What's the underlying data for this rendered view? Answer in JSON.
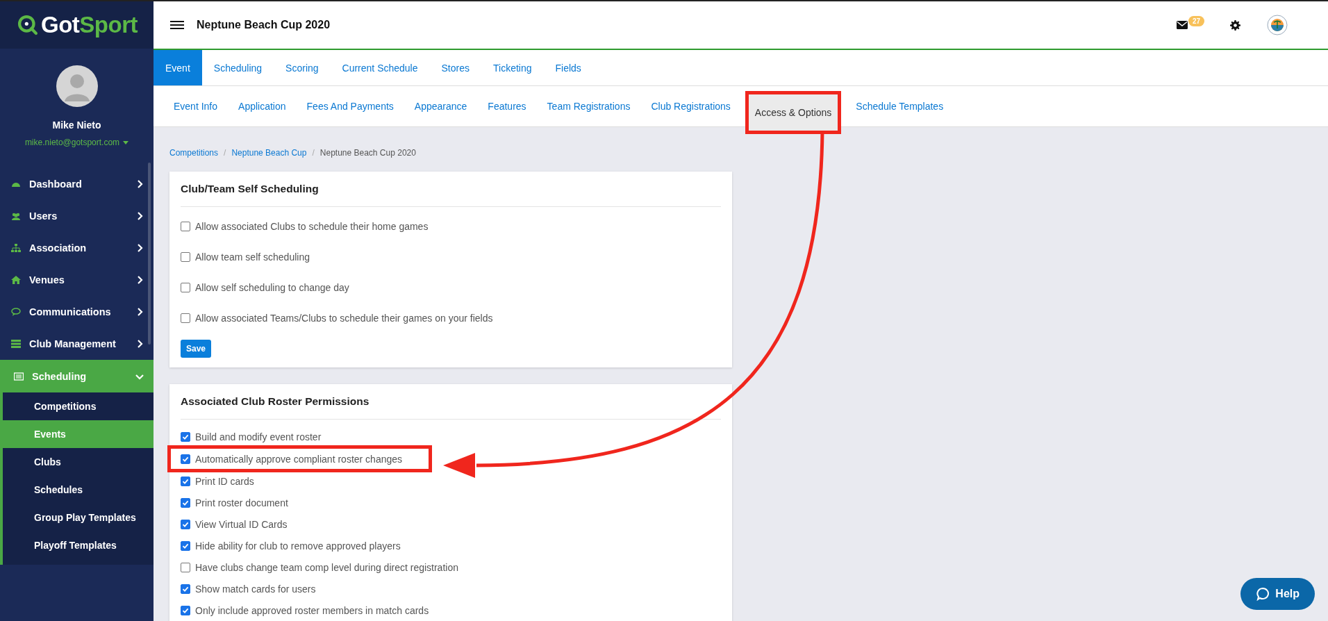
{
  "brand": {
    "name_left": "Got",
    "name_right": "Sport"
  },
  "user": {
    "name": "Mike Nieto",
    "email": "mike.nieto@gotsport.com"
  },
  "sidebar": {
    "items": [
      {
        "label": "Dashboard",
        "expanded": false,
        "selected": false
      },
      {
        "label": "Users",
        "expanded": false,
        "selected": false
      },
      {
        "label": "Association",
        "expanded": false,
        "selected": false
      },
      {
        "label": "Venues",
        "expanded": false,
        "selected": false
      },
      {
        "label": "Communications",
        "expanded": false,
        "selected": false
      },
      {
        "label": "Club Management",
        "expanded": false,
        "selected": false
      },
      {
        "label": "Scheduling",
        "expanded": true,
        "selected": true,
        "children": [
          {
            "label": "Competitions",
            "selected": false
          },
          {
            "label": "Events",
            "selected": true
          },
          {
            "label": "Clubs",
            "selected": false
          },
          {
            "label": "Schedules",
            "selected": false
          },
          {
            "label": "Group Play Templates",
            "selected": false
          },
          {
            "label": "Playoff Templates",
            "selected": false
          }
        ]
      }
    ]
  },
  "header": {
    "title": "Neptune Beach Cup 2020",
    "mail_count": "27"
  },
  "tabs": [
    {
      "label": "Event",
      "selected": true
    },
    {
      "label": "Scheduling",
      "selected": false
    },
    {
      "label": "Scoring",
      "selected": false
    },
    {
      "label": "Current Schedule",
      "selected": false
    },
    {
      "label": "Stores",
      "selected": false
    },
    {
      "label": "Ticketing",
      "selected": false
    },
    {
      "label": "Fields",
      "selected": false
    }
  ],
  "subtabs": [
    {
      "label": "Event Info",
      "selected": false,
      "highlighted": false
    },
    {
      "label": "Application",
      "selected": false,
      "highlighted": false
    },
    {
      "label": "Fees And Payments",
      "selected": false,
      "highlighted": false
    },
    {
      "label": "Appearance",
      "selected": false,
      "highlighted": false
    },
    {
      "label": "Features",
      "selected": false,
      "highlighted": false
    },
    {
      "label": "Team Registrations",
      "selected": false,
      "highlighted": false
    },
    {
      "label": "Club Registrations",
      "selected": false,
      "highlighted": false
    },
    {
      "label": "Access & Options",
      "selected": true,
      "highlighted": true
    },
    {
      "label": "Schedule Templates",
      "selected": false,
      "highlighted": false
    }
  ],
  "breadcrumb": [
    {
      "label": "Competitions",
      "link": true
    },
    {
      "separator": "/",
      "label": "Neptune Beach Cup",
      "link": true
    },
    {
      "separator": "/",
      "label": "Neptune Beach Cup 2020",
      "link": false
    }
  ],
  "cards": [
    {
      "title": "Club/Team Self Scheduling",
      "save_label": "Save",
      "options": [
        {
          "label": "Allow associated Clubs to schedule their home games",
          "checked": false,
          "highlighted": false
        },
        {
          "label": "Allow team self scheduling",
          "checked": false,
          "highlighted": false
        },
        {
          "label": "Allow self scheduling to change day",
          "checked": false,
          "highlighted": false
        },
        {
          "label": "Allow associated Teams/Clubs to schedule their games on your fields",
          "checked": false,
          "highlighted": false
        }
      ]
    },
    {
      "title": "Associated Club Roster Permissions",
      "options": [
        {
          "label": "Build and modify event roster",
          "checked": true,
          "highlighted": false
        },
        {
          "label": "Automatically approve compliant roster changes",
          "checked": true,
          "highlighted": true
        },
        {
          "label": "Print ID cards",
          "checked": true,
          "highlighted": false
        },
        {
          "label": "Print roster document",
          "checked": true,
          "highlighted": false
        },
        {
          "label": "View Virtual ID Cards",
          "checked": true,
          "highlighted": false
        },
        {
          "label": "Hide ability for club to remove approved players",
          "checked": true,
          "highlighted": false
        },
        {
          "label": "Have clubs change team comp level during direct registration",
          "checked": false,
          "highlighted": false
        },
        {
          "label": "Show match cards for users",
          "checked": true,
          "highlighted": false
        },
        {
          "label": "Only include approved roster members in match cards",
          "checked": true,
          "highlighted": false
        }
      ]
    }
  ],
  "help": {
    "label": "Help"
  }
}
